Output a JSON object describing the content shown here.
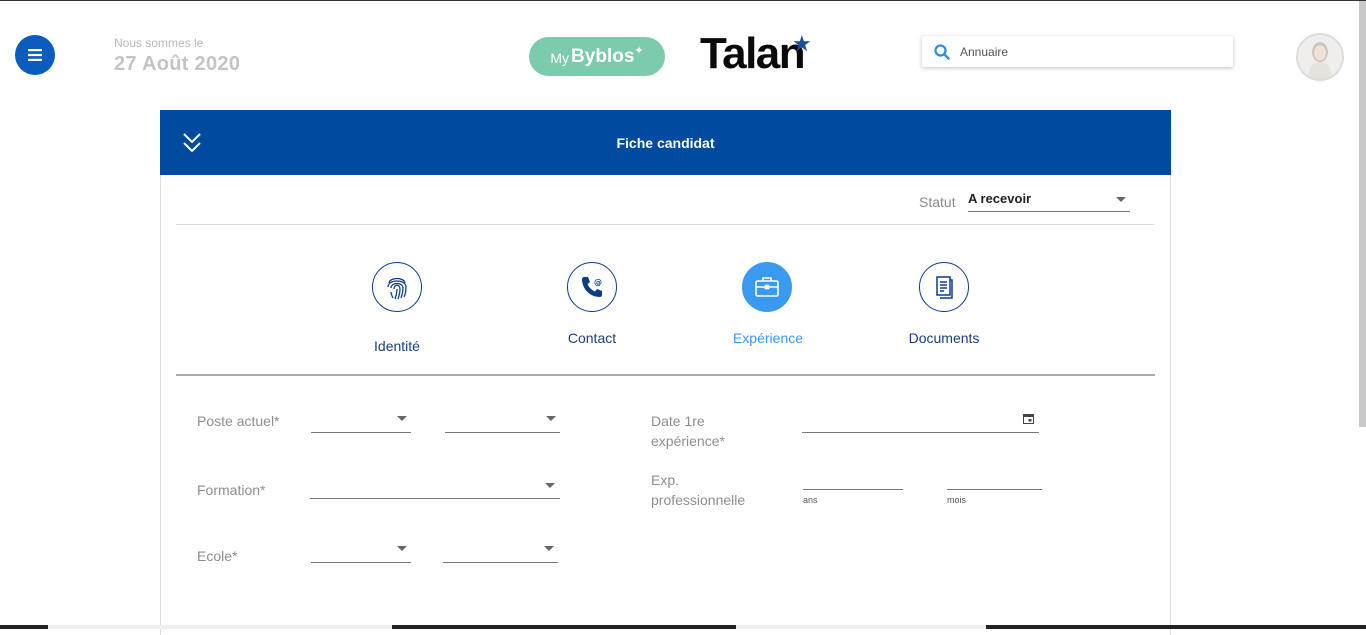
{
  "header": {
    "date_label": "Nous sommes le",
    "date_value": "27 Août 2020",
    "mybyblos_my": "My",
    "mybyblos_byblos": "Byblos",
    "brand": "Talan",
    "search_placeholder": "Annuaire"
  },
  "panel": {
    "title": "Fiche candidat",
    "statut_label": "Statut",
    "statut_value": "A recevoir"
  },
  "steps": [
    {
      "label": "Identité",
      "icon": "fingerprint-icon",
      "active": false
    },
    {
      "label": "Contact",
      "icon": "phone-icon",
      "active": false
    },
    {
      "label": "Expérience",
      "icon": "briefcase-icon",
      "active": true
    },
    {
      "label": "Documents",
      "icon": "document-icon",
      "active": false
    }
  ],
  "form": {
    "poste_actuel": "Poste actuel*",
    "formation": "Formation*",
    "ecole": "Ecole*",
    "date_1re_line1": "Date 1re",
    "date_1re_line2": "expérience*",
    "exp_line1": "Exp.",
    "exp_line2": "professionnelle",
    "ans": "ans",
    "mois": "mois"
  },
  "colors": {
    "primary": "#004a9f",
    "accent": "#3a9af2",
    "mybyblos": "#7ccbad"
  }
}
